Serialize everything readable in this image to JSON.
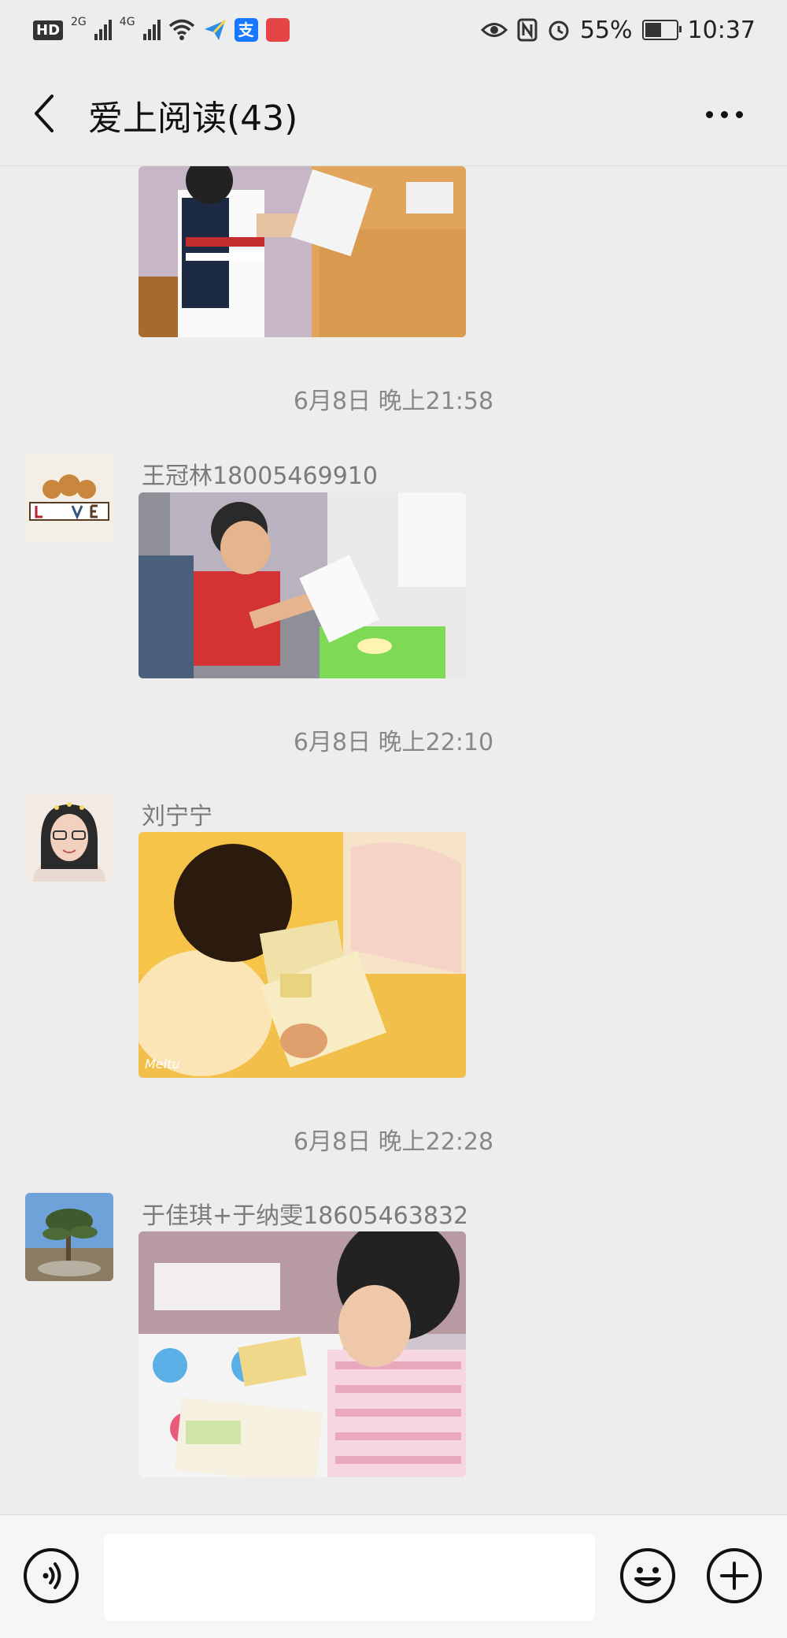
{
  "status_bar": {
    "hd": "HD",
    "net1": "2G",
    "net2": "4G",
    "battery_percent": "55%",
    "battery_level": 0.55,
    "time": "10:37",
    "app_badge_2": "支"
  },
  "header": {
    "title": "爱上阅读(43)"
  },
  "messages": [
    {
      "timestamp": "6月8日 晚上21:58",
      "sender": "王冠林18005469910"
    },
    {
      "timestamp": "6月8日 晚上22:10",
      "sender": "刘宁宁"
    },
    {
      "timestamp": "6月8日 晚上22:28",
      "sender": "于佳琪+于纳雯18605463832"
    }
  ],
  "input": {
    "value": ""
  },
  "icons": {
    "voice": "voice-icon",
    "emoji": "emoji-icon",
    "add": "plus-icon",
    "back": "back-arrow-icon",
    "more": "more-icon"
  },
  "colors": {
    "background": "#ededed",
    "timestamp": "#888888",
    "sender": "#7a7a7a"
  }
}
